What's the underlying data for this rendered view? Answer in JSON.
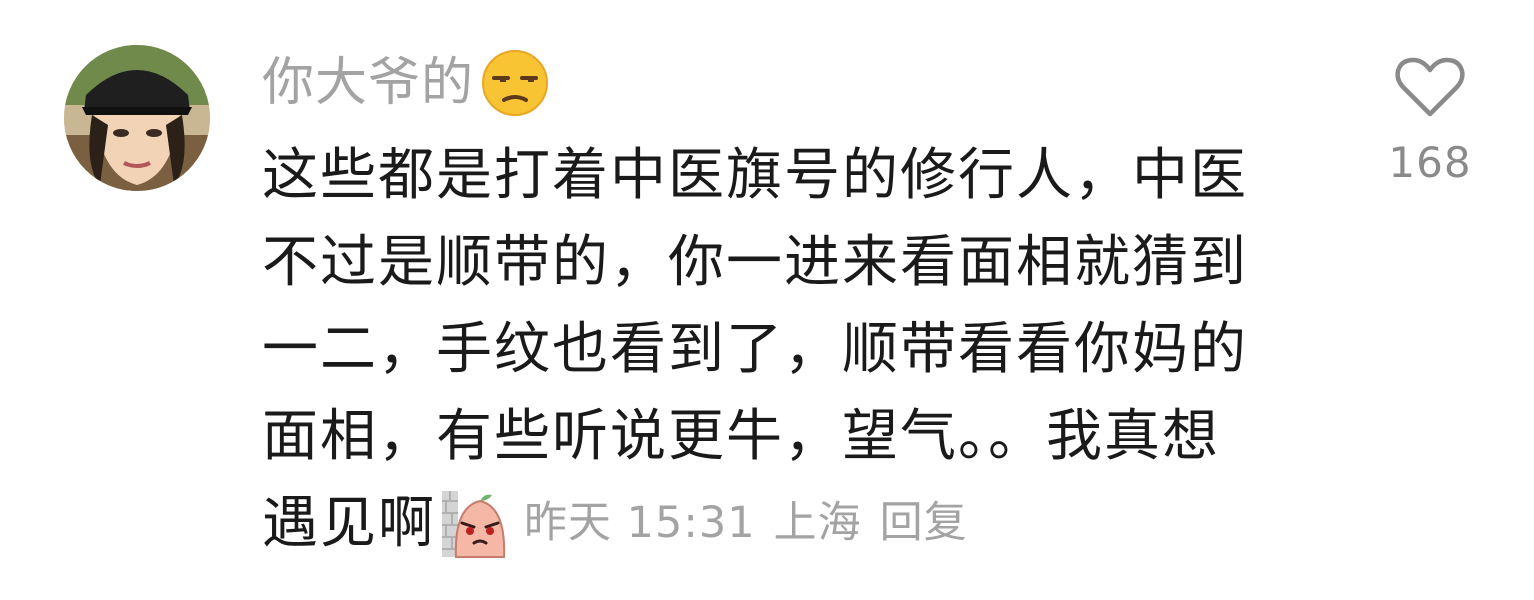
{
  "comment": {
    "username": "你大爷的",
    "username_emoji": "unamused-face-emoji",
    "text_lines": [
      "这些都是打着中医旗号的修行人，中医",
      "不过是顺带的，你一进来看面相就猜到",
      "一二，手纹也看到了，顺带看看你妈的",
      "面相，有些听说更牛，望气。。我真想",
      "遇见啊"
    ],
    "sticker": "peeking-peach-sticker",
    "time": "昨天 15:31",
    "location": "上海",
    "reply_label": "回复"
  },
  "like": {
    "icon": "heart-outline-icon",
    "count": "168"
  },
  "colors": {
    "text": "#1a1a1a",
    "muted": "#a3a3a3",
    "like_count": "#8a8a8a"
  }
}
